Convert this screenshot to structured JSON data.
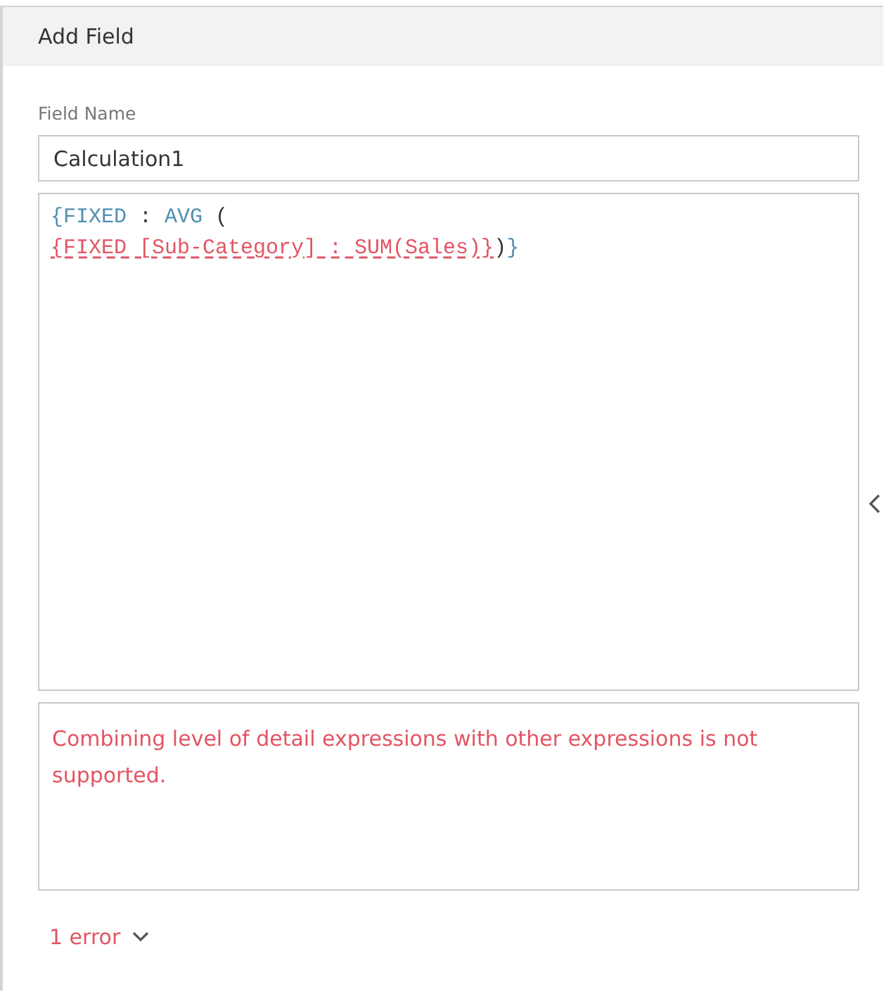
{
  "header": {
    "title": "Add Field"
  },
  "field_name": {
    "label": "Field Name",
    "value": "Calculation1"
  },
  "formula": {
    "lines": [
      [
        {
          "text": "{FIXED",
          "kind": "keyword"
        },
        {
          "text": " : ",
          "kind": "plain"
        },
        {
          "text": "AVG",
          "kind": "keyword"
        },
        {
          "text": " (",
          "kind": "plain"
        }
      ],
      [
        {
          "text": "{FIXED [Sub-Category] : SUM(Sales)}",
          "kind": "error"
        },
        {
          "text": ")",
          "kind": "plain"
        },
        {
          "text": "}",
          "kind": "keyword"
        }
      ]
    ]
  },
  "message": "Combining level of detail expressions with other expressions is not supported.",
  "error_count": "1 error"
}
